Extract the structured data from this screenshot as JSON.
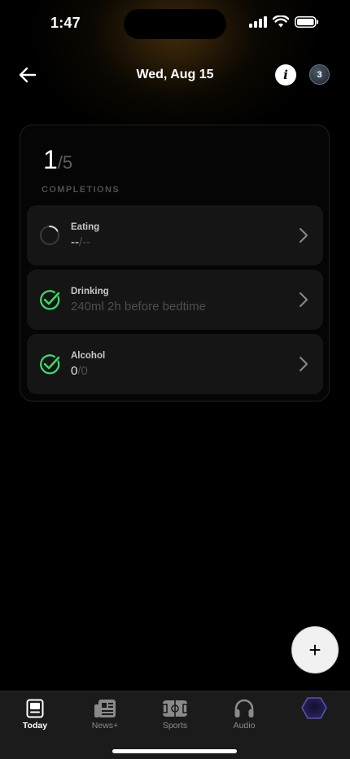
{
  "status_bar": {
    "time": "1:47"
  },
  "header": {
    "title": "Wed, Aug 15",
    "avatar_badge": "3"
  },
  "summary": {
    "completed": "1",
    "total": "/5",
    "label": "COMPLETIONS"
  },
  "rows": [
    {
      "title": "Eating",
      "value_primary": "--",
      "value_secondary": "/--",
      "status": "in-progress"
    },
    {
      "title": "Drinking",
      "value_primary": "",
      "value_secondary": "240ml 2h before bedtime",
      "status": "done"
    },
    {
      "title": "Alcohol",
      "value_primary": "0",
      "value_secondary": "/0",
      "status": "done"
    }
  ],
  "fab": {
    "label": "+"
  },
  "tabs": [
    {
      "label": "Today",
      "icon": "today-icon",
      "active": true
    },
    {
      "label": "News+",
      "icon": "news-icon",
      "active": false
    },
    {
      "label": "Sports",
      "icon": "sports-icon",
      "active": false
    },
    {
      "label": "Audio",
      "icon": "headphones-icon",
      "active": false
    },
    {
      "label": "",
      "icon": "profile-gem-icon",
      "active": false
    }
  ],
  "colors": {
    "accent_green": "#3ddc6b",
    "background": "#000000",
    "card_row": "#151515"
  }
}
